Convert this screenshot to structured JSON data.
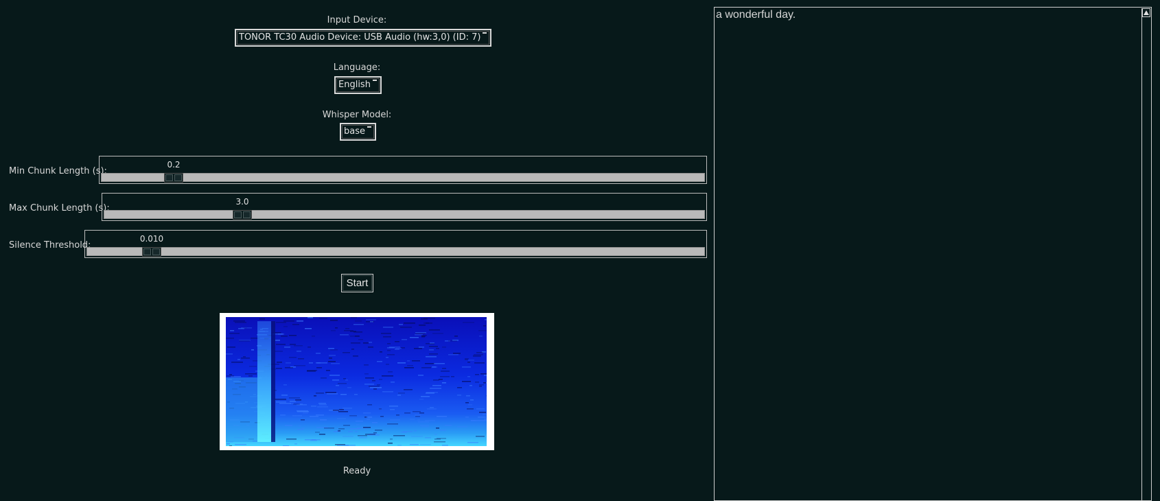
{
  "input_device": {
    "label": "Input Device:",
    "selected": "TONOR TC30 Audio Device: USB Audio (hw:3,0) (ID: 7)"
  },
  "language": {
    "label": "Language:",
    "selected": "English"
  },
  "whisper_model": {
    "label": "Whisper Model:",
    "selected": "base"
  },
  "sliders": {
    "min_chunk": {
      "label": "Min Chunk Length (s):",
      "value": "0.2",
      "fraction": 0.12
    },
    "max_chunk": {
      "label": "Max Chunk Length (s):",
      "value": "3.0",
      "fraction": 0.23
    },
    "silence": {
      "label": "Silence Threshold:",
      "value": "0.010",
      "fraction": 0.105
    }
  },
  "start_button": {
    "label": "Start"
  },
  "status": {
    "text": "Ready"
  },
  "transcript": {
    "text": "a wonderful day."
  },
  "colors": {
    "background": "#07191a",
    "spectrogram_low": "#0a1fd6",
    "spectrogram_high": "#4fe6ff"
  }
}
